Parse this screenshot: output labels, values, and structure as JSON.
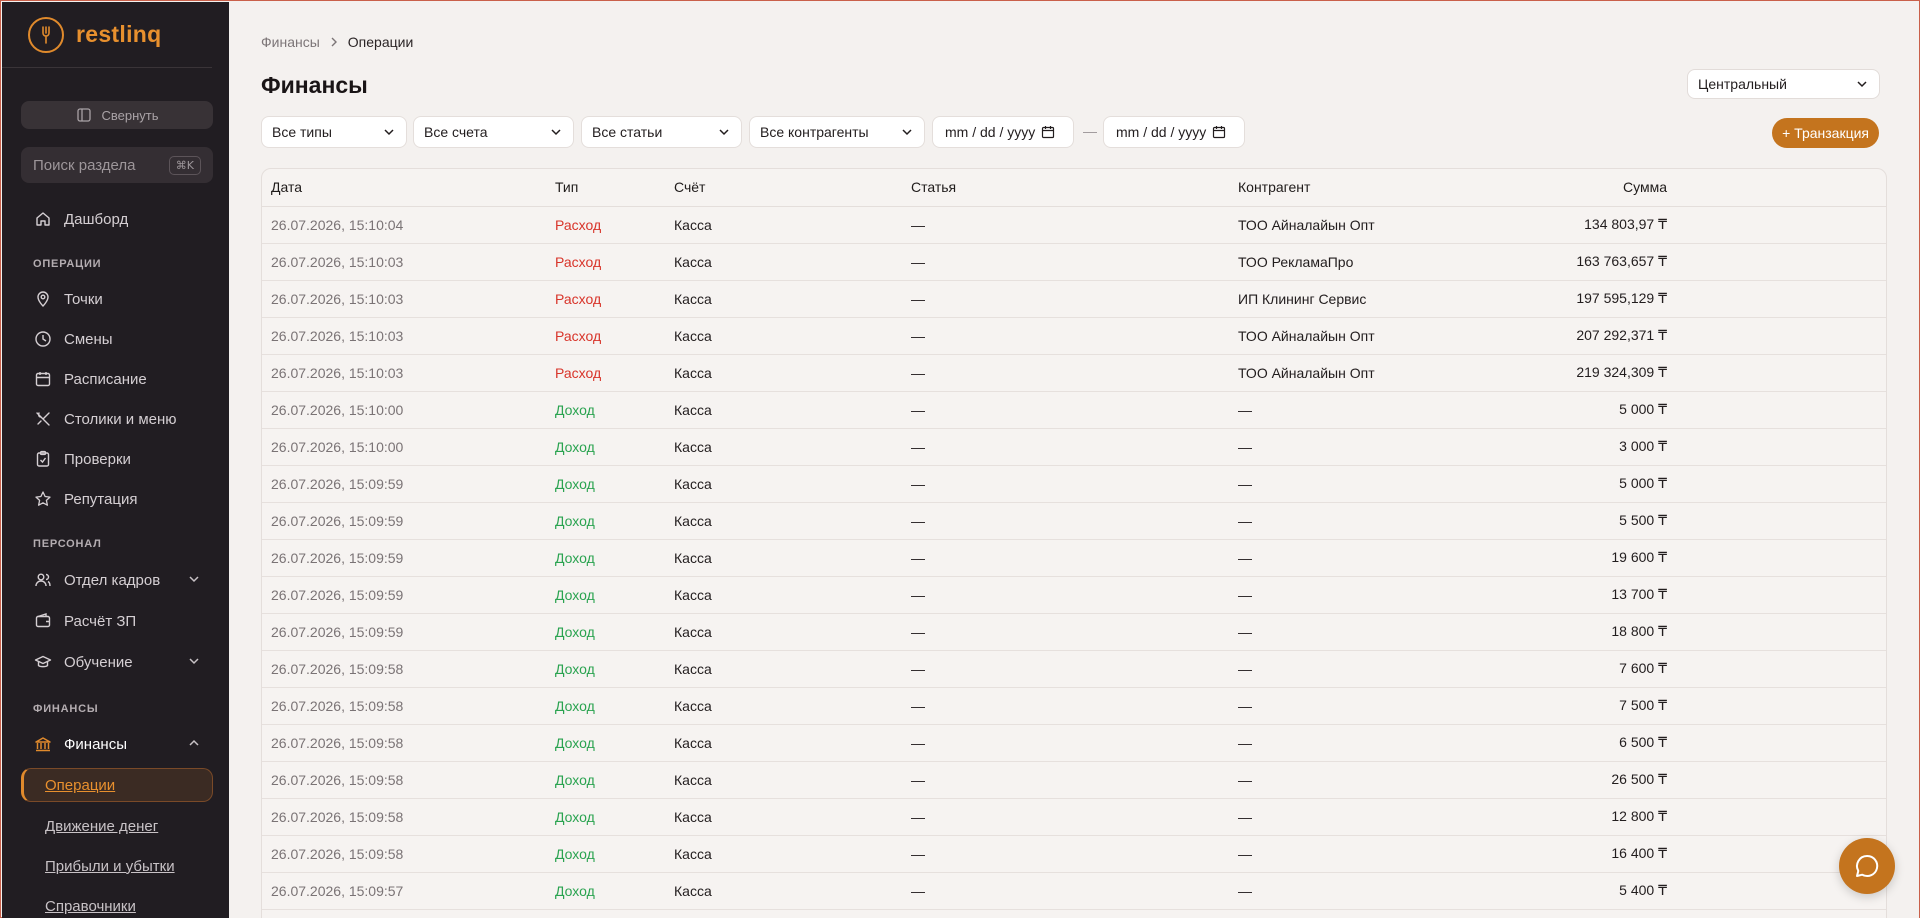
{
  "brand": {
    "name": "restlinq"
  },
  "sidebar": {
    "collapse_label": "Свернуть",
    "search_placeholder": "Поиск раздела",
    "search_shortcut": "⌘K",
    "dashboard": "Дашборд",
    "sections": {
      "operations": "ОПЕРАЦИИ",
      "staff": "ПЕРСОНАЛ",
      "finance": "ФИНАНСЫ"
    },
    "operations_items": [
      "Точки",
      "Смены",
      "Расписание",
      "Столики и меню",
      "Проверки",
      "Репутация"
    ],
    "staff_items": [
      "Отдел кадров",
      "Расчёт ЗП",
      "Обучение"
    ],
    "finance_parent": "Финансы",
    "finance_sub": [
      "Операции",
      "Движение денег",
      "Прибыли и убытки",
      "Справочники"
    ]
  },
  "breadcrumb": {
    "parent": "Финансы",
    "current": "Операции"
  },
  "page": {
    "title": "Финансы"
  },
  "branch_select": {
    "value": "Центральный"
  },
  "filters": {
    "types": "Все типы",
    "accounts": "Все счета",
    "items": "Все статьи",
    "counterparties": "Все контрагенты",
    "date_from": "mm / dd / yyyy",
    "date_to": "mm / dd / yyyy",
    "date_separator": "—"
  },
  "add_button": "+ Транзакция",
  "table": {
    "headers": [
      "Дата",
      "Тип",
      "Счёт",
      "Статья",
      "Контрагент",
      "Сумма"
    ],
    "rows": [
      [
        "26.07.2026, 15:10:04",
        "Расход",
        "Касса",
        "—",
        "ТОО Айналайын Опт",
        "134 803,97 ₸"
      ],
      [
        "26.07.2026, 15:10:03",
        "Расход",
        "Касса",
        "—",
        "ТОО РекламаПро",
        "163 763,657 ₸"
      ],
      [
        "26.07.2026, 15:10:03",
        "Расход",
        "Касса",
        "—",
        "ИП Клининг Сервис",
        "197 595,129 ₸"
      ],
      [
        "26.07.2026, 15:10:03",
        "Расход",
        "Касса",
        "—",
        "ТОО Айналайын Опт",
        "207 292,371 ₸"
      ],
      [
        "26.07.2026, 15:10:03",
        "Расход",
        "Касса",
        "—",
        "ТОО Айналайын Опт",
        "219 324,309 ₸"
      ],
      [
        "26.07.2026, 15:10:00",
        "Доход",
        "Касса",
        "—",
        "—",
        "5 000 ₸"
      ],
      [
        "26.07.2026, 15:10:00",
        "Доход",
        "Касса",
        "—",
        "—",
        "3 000 ₸"
      ],
      [
        "26.07.2026, 15:09:59",
        "Доход",
        "Касса",
        "—",
        "—",
        "5 000 ₸"
      ],
      [
        "26.07.2026, 15:09:59",
        "Доход",
        "Касса",
        "—",
        "—",
        "5 500 ₸"
      ],
      [
        "26.07.2026, 15:09:59",
        "Доход",
        "Касса",
        "—",
        "—",
        "19 600 ₸"
      ],
      [
        "26.07.2026, 15:09:59",
        "Доход",
        "Касса",
        "—",
        "—",
        "13 700 ₸"
      ],
      [
        "26.07.2026, 15:09:59",
        "Доход",
        "Касса",
        "—",
        "—",
        "18 800 ₸"
      ],
      [
        "26.07.2026, 15:09:58",
        "Доход",
        "Касса",
        "—",
        "—",
        "7 600 ₸"
      ],
      [
        "26.07.2026, 15:09:58",
        "Доход",
        "Касса",
        "—",
        "—",
        "7 500 ₸"
      ],
      [
        "26.07.2026, 15:09:58",
        "Доход",
        "Касса",
        "—",
        "—",
        "6 500 ₸"
      ],
      [
        "26.07.2026, 15:09:58",
        "Доход",
        "Касса",
        "—",
        "—",
        "26 500 ₸"
      ],
      [
        "26.07.2026, 15:09:58",
        "Доход",
        "Касса",
        "—",
        "—",
        "12 800 ₸"
      ],
      [
        "26.07.2026, 15:09:58",
        "Доход",
        "Касса",
        "—",
        "—",
        "16 400 ₸"
      ],
      [
        "26.07.2026, 15:09:57",
        "Доход",
        "Касса",
        "—",
        "—",
        "5 400 ₸"
      ]
    ]
  },
  "colors": {
    "accent": "#e08a2c",
    "expense": "#d8342a",
    "income": "#2aa350",
    "sidebar_bg": "#211d22"
  }
}
